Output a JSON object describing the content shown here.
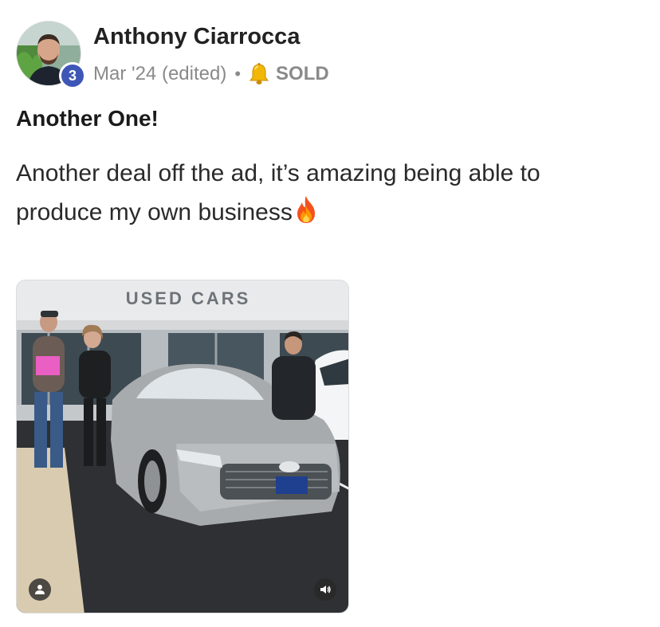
{
  "post": {
    "author": {
      "name": "Anthony Ciarrocca",
      "level": "3"
    },
    "date": "Mar '24 (edited)",
    "separator": "•",
    "category": "SOLD",
    "title": "Another One!",
    "body": "Another deal off the ad, it’s amazing being able to produce my own business",
    "image": {
      "sign_text": "USED CARS"
    }
  },
  "icons": {
    "bell": "bell-icon",
    "fire": "fire-icon",
    "profile": "person-icon",
    "sound": "speaker-icon"
  },
  "colors": {
    "level_badge": "#3e56b5",
    "meta_text": "#8a8a8a"
  }
}
